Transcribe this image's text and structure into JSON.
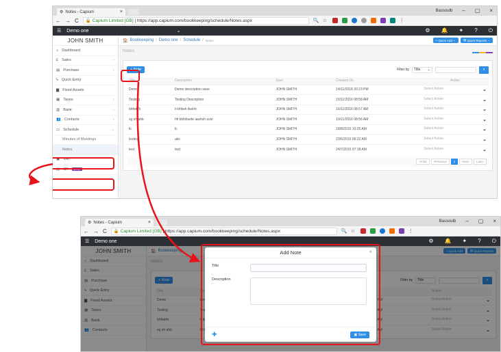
{
  "browser": {
    "tab_title": "Notes - Capium",
    "secure_label": "Capium Limited [GB]",
    "url": "https://app.capium.com/bookkeeping/schedule/Notes.aspx",
    "window_user": "Bassoulb"
  },
  "topbar": {
    "company": "Demo one"
  },
  "sidebar": {
    "user": "JOHN SMITH",
    "items": [
      {
        "label": "Dashboard",
        "icon": "home-icon"
      },
      {
        "label": "Sales",
        "icon": "pound-icon"
      },
      {
        "label": "Purchase",
        "icon": "cart-icon"
      },
      {
        "label": "Quick Entry",
        "icon": "bolt-icon"
      },
      {
        "label": "Fixed Assets",
        "icon": "book-icon"
      },
      {
        "label": "Taxes",
        "icon": "tax-icon"
      },
      {
        "label": "Bank",
        "icon": "bank-icon"
      },
      {
        "label": "Contacts",
        "icon": "users-icon"
      },
      {
        "label": "Schedule",
        "icon": "calendar-icon"
      },
      {
        "label": "Minutes of Meetings"
      },
      {
        "label": "Notes"
      },
      {
        "label": "VAT",
        "icon": "vat-icon"
      },
      {
        "label": "CT",
        "badge": "Beta",
        "icon": "ct-icon"
      }
    ]
  },
  "breadcrumb": {
    "root": "Bookkeeping",
    "company": "Demo one",
    "section": "Schedule",
    "current": "Notes"
  },
  "header_buttons": {
    "quick_add": "Quick Add",
    "quick_reports": "Quick Reports"
  },
  "page_title": "Notes",
  "panel": {
    "add_button": "+ Note",
    "filter_label": "Filter by",
    "filter_value": "Title",
    "columns": [
      "Title",
      "Description",
      "User",
      "Created On",
      "Action"
    ],
    "rows": [
      {
        "title": "Demo",
        "description": "Demo description save",
        "user": "JOHN SMITH",
        "created": "14/11/2018 20:23 PM",
        "action": "Select Action"
      },
      {
        "title": "Testing",
        "description": "Testing Description",
        "user": "JOHN SMITH",
        "created": "15/11/2016 08:58 AM",
        "action": "Select Action"
      },
      {
        "title": "bhfwkfh",
        "description": "h bhfwh lkwhh",
        "user": "JOHN SMITH",
        "created": "16/11/2016 08:57 AM",
        "action": "Select Action"
      },
      {
        "title": "xg eh ahb",
        "description": "hfi bkfsbsefe iawhvh avio",
        "user": "JOHN SMITH",
        "created": "19/11/2016 08:56 AM",
        "action": "Select Action"
      },
      {
        "title": "fc",
        "description": "fc",
        "user": "JOHN SMITH",
        "created": "18/8/2016 10:25 AM",
        "action": "Select Action"
      },
      {
        "title": "testing",
        "description": "abc",
        "user": "JOHN SMITH",
        "created": "23/6/2016 08:22 AM",
        "action": "Select Action"
      },
      {
        "title": "test",
        "description": "test",
        "user": "JOHN SMITH",
        "created": "24/7/2015 07:18 AM",
        "action": "Select Action"
      }
    ],
    "pager": {
      "first": "«First",
      "prev": "‹Previous",
      "page": "1",
      "next": "Next›",
      "last": "Last»"
    }
  },
  "modal": {
    "title": "Add Note",
    "title_label": "Title",
    "description_label": "Description",
    "save": "Save"
  },
  "colors": {
    "annotation": "#e8121b",
    "accent": "#2f8fe6"
  }
}
